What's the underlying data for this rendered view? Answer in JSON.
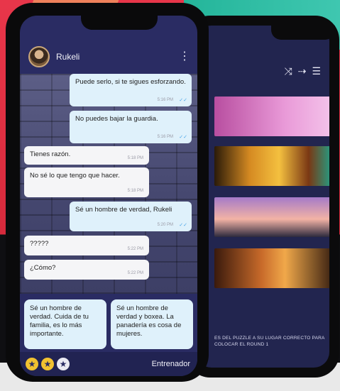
{
  "chat": {
    "contact_name": "Rukeli",
    "messages": [
      {
        "side": "out",
        "text": "Puede serlo, si te sigues esforzando.",
        "time": "5:16 PM",
        "read": true
      },
      {
        "side": "out",
        "text": "No puedes bajar la guardia.",
        "time": "5:16 PM",
        "read": true
      },
      {
        "side": "in",
        "text": "Tienes razón.",
        "time": "5:18 PM"
      },
      {
        "side": "in",
        "text": "No sé lo que tengo que hacer.",
        "time": "5:18 PM"
      },
      {
        "side": "out",
        "text": "Sé un hombre de verdad, Rukeli",
        "time": "5:20 PM",
        "read": true
      },
      {
        "side": "in",
        "text": "?????",
        "time": "5:22 PM"
      },
      {
        "side": "in",
        "text": "¿Cómo?",
        "time": "5:22 PM"
      }
    ],
    "options": [
      "Sé un hombre de verdad. Cuida de tu familia, es lo más importante.",
      "Sé un hombre de verdad y boxea. La panadería es cosa de mujeres."
    ],
    "stars": {
      "earned": 2,
      "total": 3
    },
    "coach_label": "Entrenador"
  },
  "secondary_screen": {
    "footer_text": "ES DEL PUZZLE A SU LUGAR CORRECTO PARA COLOCAR EL ROUND 1"
  },
  "colors": {
    "screen_bg": "#2a2c63",
    "bubble_out": "#dff1fb",
    "bubble_in": "#f5f5f7",
    "star_gold": "#f2c230"
  }
}
